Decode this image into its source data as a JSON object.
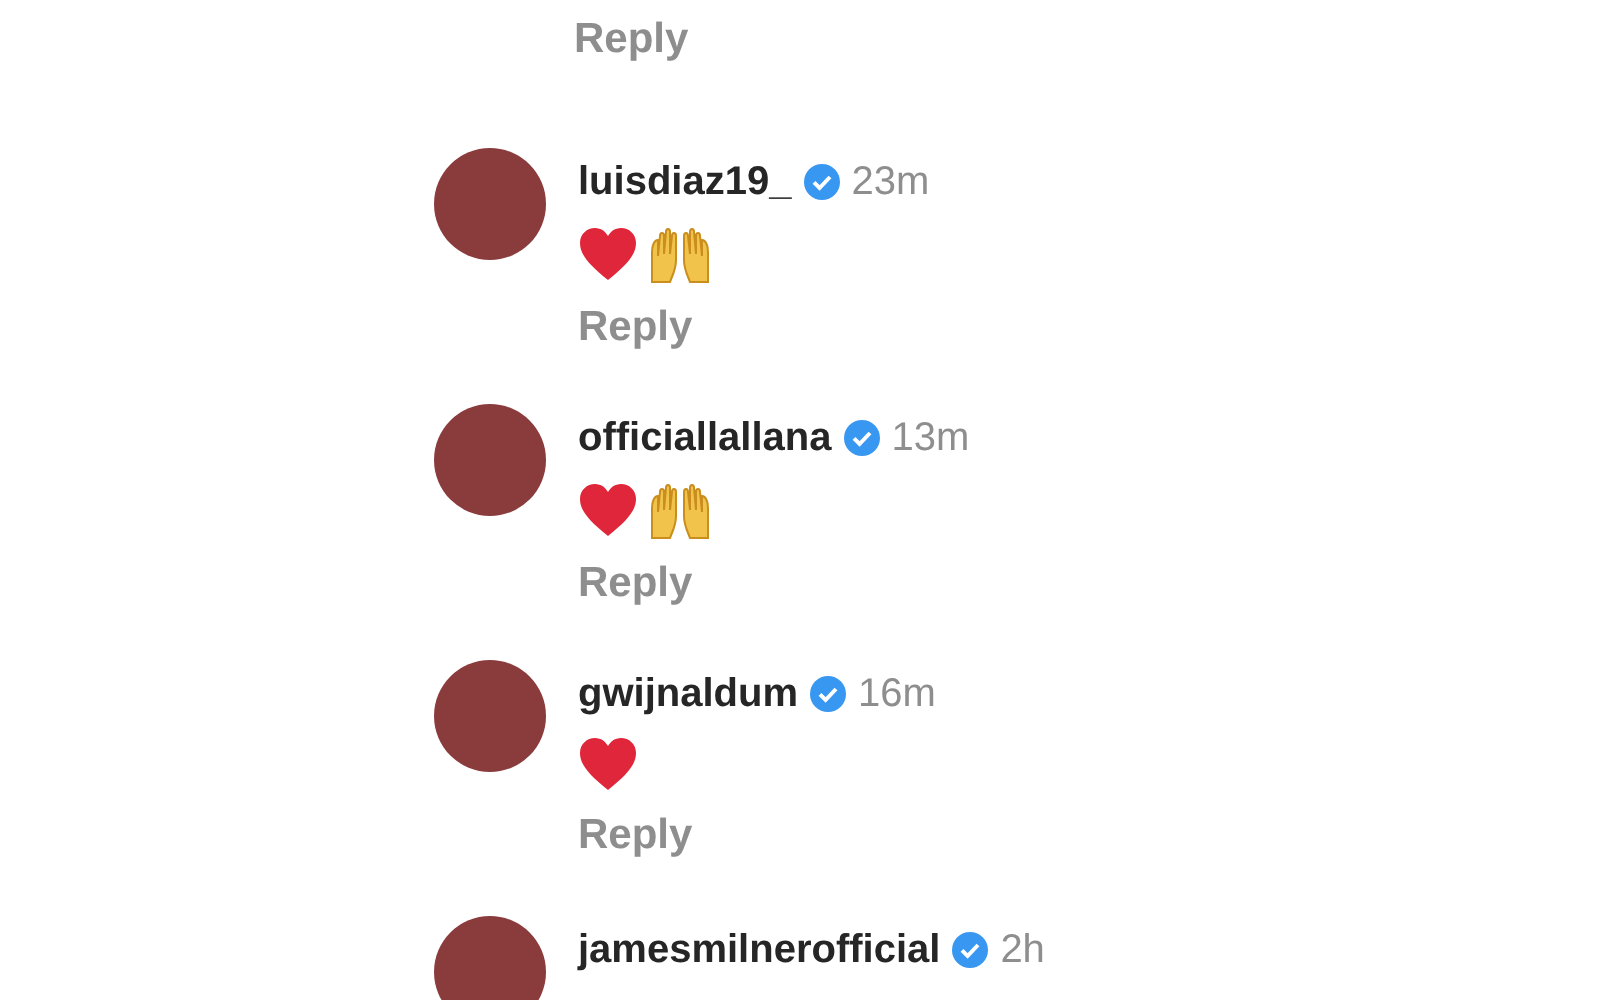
{
  "top_reply": "Reply",
  "comments": [
    {
      "username": "luisdiaz19_",
      "verified": true,
      "time": "23m",
      "reactions": [
        {
          "kind": "heart"
        },
        {
          "kind": "raised-hands"
        }
      ],
      "reply": "Reply"
    },
    {
      "username": "officiallallana",
      "verified": true,
      "time": "13m",
      "reactions": [
        {
          "kind": "heart"
        },
        {
          "kind": "raised-hands"
        }
      ],
      "reply": "Reply"
    },
    {
      "username": "gwijnaldum",
      "verified": true,
      "time": "16m",
      "reactions": [
        {
          "kind": "heart"
        }
      ],
      "reply": "Reply"
    },
    {
      "username": "jamesmilnerofficial",
      "verified": true,
      "time": "2h"
    }
  ]
}
